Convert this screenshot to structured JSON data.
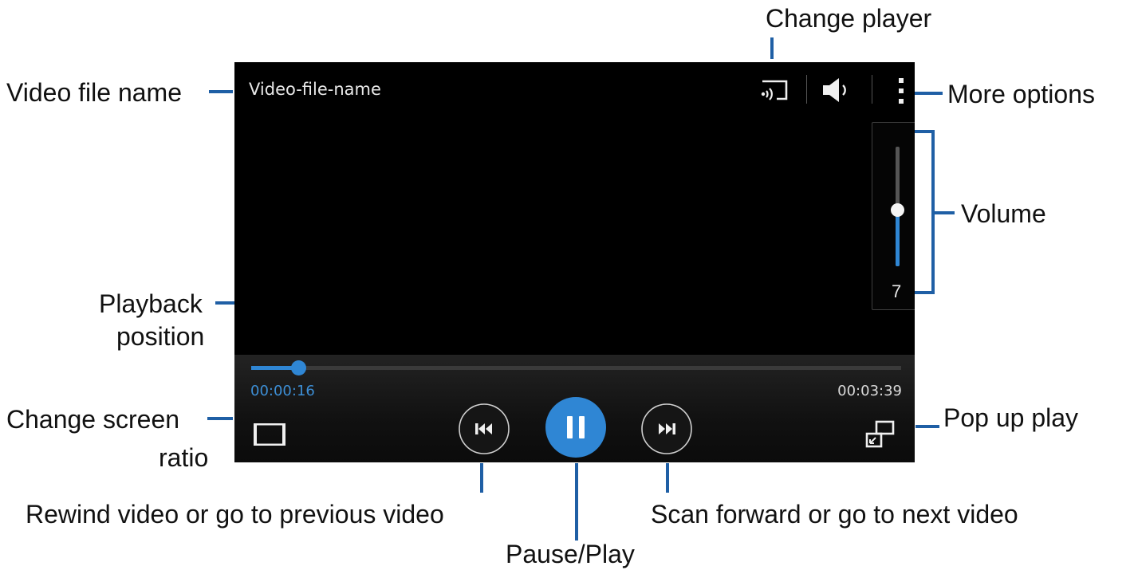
{
  "player": {
    "file_name": "Video-file-name",
    "current_time": "00:00:16",
    "total_time": "00:03:39",
    "playback_progress": 0.073,
    "volume": {
      "value": "7",
      "level": 0.47
    },
    "state": "playing"
  },
  "callouts": {
    "change_player": "Change player",
    "video_file_name": "Video file name",
    "more_options": "More options",
    "volume": "Volume",
    "playback_position_line1": "Playback",
    "playback_position_line2": "position",
    "change_screen_ratio_line1": "Change screen",
    "change_screen_ratio_line2": "ratio",
    "pop_up_play": "Pop up play",
    "rewind": "Rewind video or go to previous video",
    "scan_forward": "Scan forward or go to next video",
    "pause_play": "Pause/Play"
  },
  "icons": {
    "change_player": "screen-mirroring-icon",
    "volume": "speaker-icon",
    "more_options": "kebab-menu-icon",
    "screen_ratio": "screen-ratio-icon",
    "rewind": "rewind-icon",
    "pause": "pause-icon",
    "forward": "fast-forward-icon",
    "pop_up_play": "pop-up-play-icon"
  },
  "colors": {
    "accent": "#2f86d4",
    "leader_line": "#1f5fa5",
    "screen_background": "#000000"
  }
}
